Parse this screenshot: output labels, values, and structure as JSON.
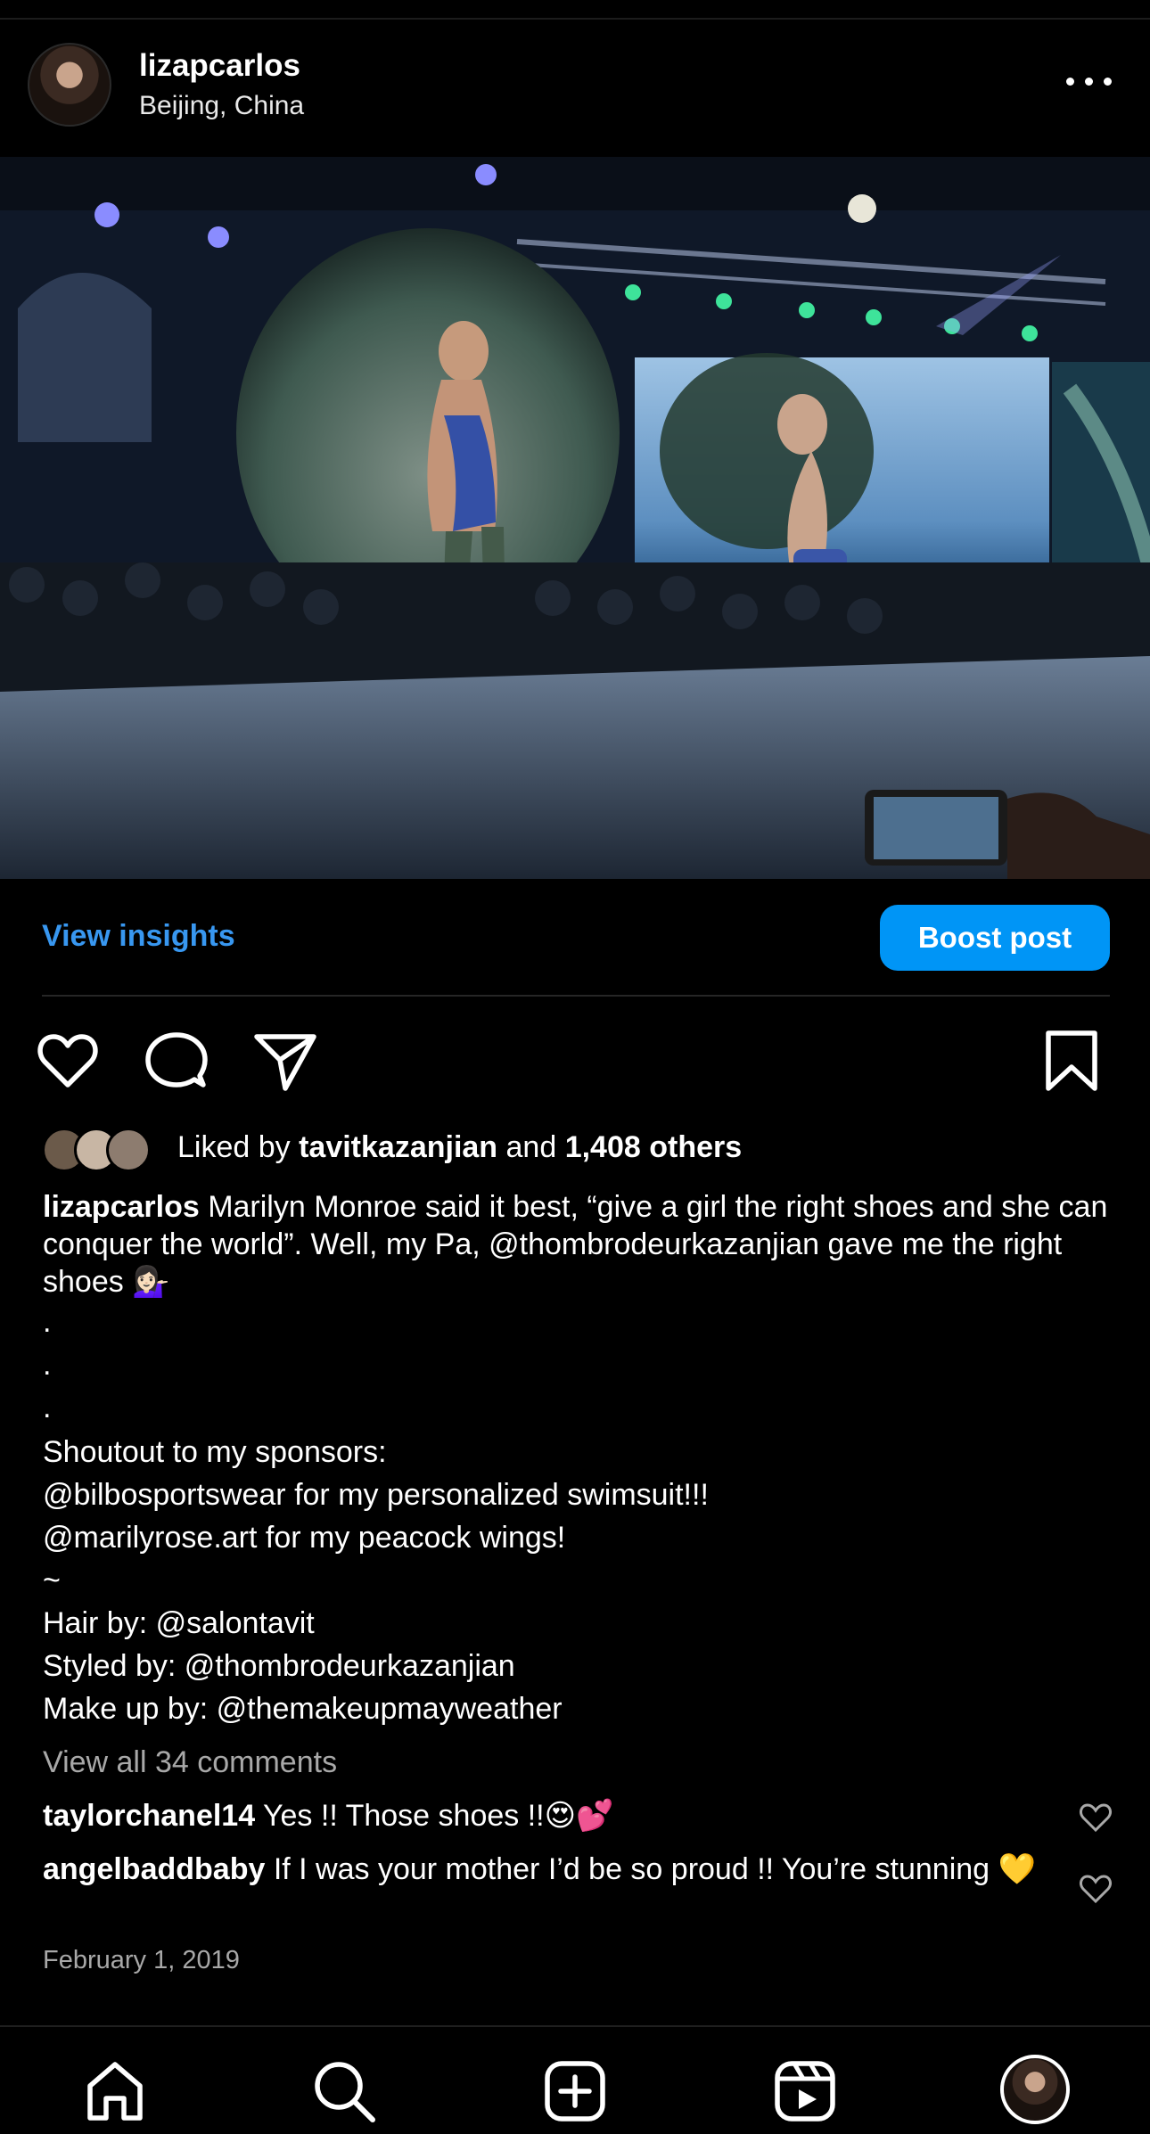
{
  "post": {
    "username": "lizapcarlos",
    "location": "Beijing, China",
    "more_icon": "more-horizontal-icon",
    "photo_alt": "runway"
  },
  "insights": {
    "view_label": "View insights",
    "boost_label": "Boost post"
  },
  "actions": [
    "heart-icon",
    "comment-icon",
    "share-icon",
    "bookmark-icon"
  ],
  "likes": {
    "prefix": "Liked by ",
    "user": "tavitkazanjian",
    "middle": " and ",
    "count": "1,408 others"
  },
  "caption": {
    "author": "lizapcarlos",
    "text": " Marilyn Monroe said it best, “give a girl the right shoes and she can conquer the world”. Well, my Pa, @thombrodeurkazanjian gave me the right shoes 💁🏻‍♀️",
    "lines": [
      ".",
      ".",
      ".",
      "Shoutout to my sponsors:",
      "@bilbosportswear for my personalized swimsuit!!!",
      "@marilyrose.art for my peacock wings!",
      "~",
      "Hair by: @salontavit",
      "Styled by: @thombrodeurkazanjian",
      "Make up by: @themakeupmayweather"
    ]
  },
  "comments": {
    "view_all": "View all 34 comments",
    "items": [
      {
        "user": "taylorchanel14",
        "text": " Yes !! Those shoes !!😍💕"
      },
      {
        "user": "angelbaddbaby",
        "text": " If I was your mother I’d be so proud !! You’re stunning 💛"
      }
    ],
    "date": "February 1, 2019"
  },
  "nav": [
    "home-icon",
    "search-icon",
    "create-icon",
    "reels-icon",
    "profile-avatar"
  ],
  "colors": {
    "accent": "#0095f6",
    "link": "#3897f0",
    "muted": "#a8a8a8",
    "background": "#000000"
  }
}
